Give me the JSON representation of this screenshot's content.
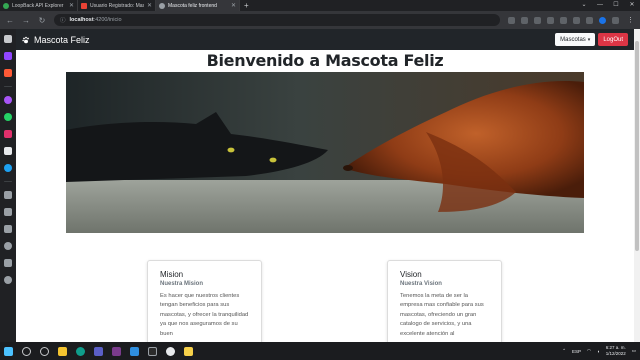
{
  "browser": {
    "tabs": [
      {
        "title": "LoopBack API Explorer",
        "color": "#34a853"
      },
      {
        "title": "Usuario Registrado: Masco",
        "color": "#ea4335"
      },
      {
        "title": "Mascota feliz frontend",
        "color": "#e8eaed"
      }
    ],
    "address": {
      "host": "localhost",
      "path": ":4200/inicio"
    }
  },
  "app": {
    "brand": "Mascota Feliz",
    "dropdown_label": "Mascotas",
    "logout_label": "LogOut",
    "title": "Bienvenido a Mascota Feliz",
    "cards": [
      {
        "title": "Mision",
        "subtitle": "Nuestra Mision",
        "text": "Es hacer que nuestros clientes tengan beneficios para sus mascotas, y ofrecer la tranquilidad ya que nos aseguramos de su buen"
      },
      {
        "title": "Vision",
        "subtitle": "Nuestra Vision",
        "text": "Tenemos la meta de ser la empresa mas confiable para sus mascotas, ofreciendo un gran catalogo de servicios, y una excelente atención al"
      }
    ]
  },
  "taskbar": {
    "lang": "ESP",
    "time": "6:27 a. m.",
    "date": "1/12/2022"
  }
}
